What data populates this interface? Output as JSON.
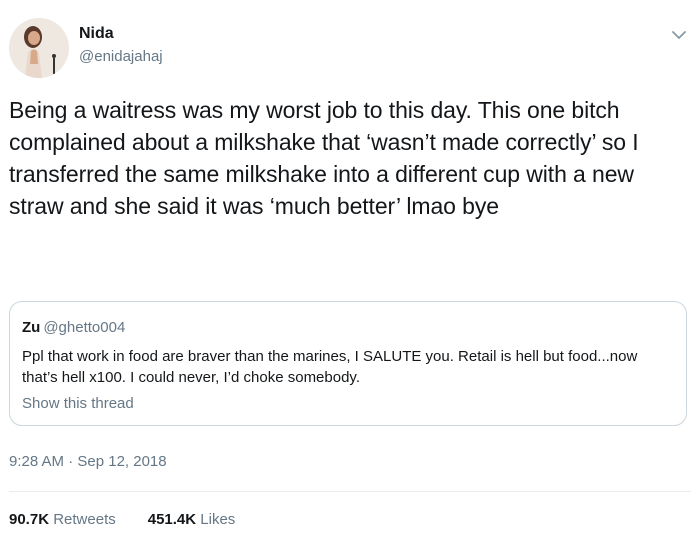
{
  "author": {
    "display_name": "Nida",
    "handle": "@enidajahaj",
    "avatar_icon": "profile-photo"
  },
  "tweet": {
    "text": "Being a waitress was my worst job to this day. This one bitch complained about a milkshake that ‘wasn’t made correctly’ so I transferred the same milkshake into a different cup with a new straw and she said it was ‘much better’ lmao bye",
    "timestamp": "9:28 AM · Sep 12, 2018"
  },
  "quoted_tweet": {
    "display_name": "Zu",
    "handle": "@ghetto004",
    "text": "Ppl that work in food are braver than the marines, I SALUTE you. Retail is hell but food...now that’s hell x100. I could never, I’d choke somebody.",
    "show_thread_label": "Show this thread"
  },
  "stats": {
    "retweets_count": "90.7K",
    "retweets_label": "Retweets",
    "likes_count": "451.4K",
    "likes_label": "Likes"
  },
  "colors": {
    "text_primary": "#14171a",
    "text_secondary": "#657786",
    "border": "#ccd6dd",
    "divider": "#e6ecf0"
  }
}
